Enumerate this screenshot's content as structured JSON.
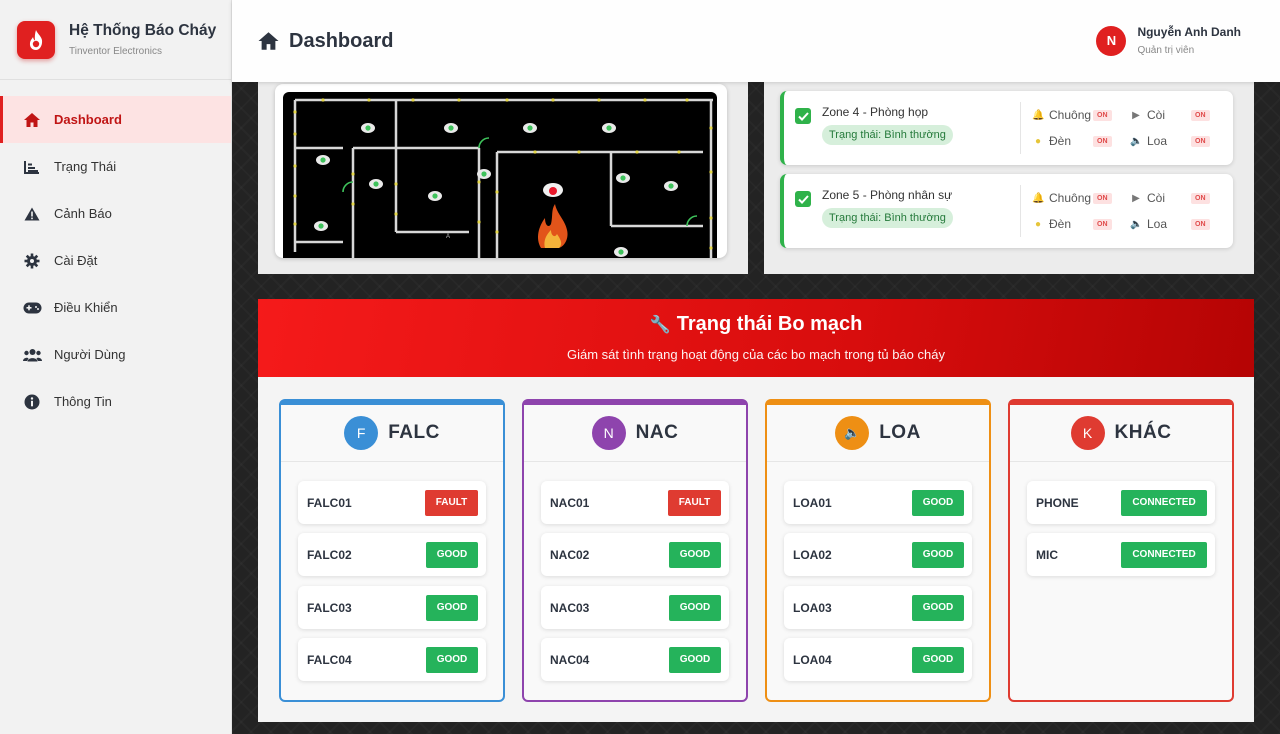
{
  "brand": {
    "title": "Hệ Thống Báo Cháy",
    "subtitle": "Tinventor Electronics"
  },
  "nav": [
    {
      "label": "Dashboard",
      "icon": "home-icon",
      "active": true
    },
    {
      "label": "Trạng Thái",
      "icon": "chart-icon"
    },
    {
      "label": "Cảnh Báo",
      "icon": "warning-icon"
    },
    {
      "label": "Cài Đặt",
      "icon": "gear-icon"
    },
    {
      "label": "Điều Khiển",
      "icon": "gamepad-icon"
    },
    {
      "label": "Người Dùng",
      "icon": "users-icon"
    },
    {
      "label": "Thông Tin",
      "icon": "info-icon"
    }
  ],
  "header": {
    "title": "Dashboard",
    "icon": "home-icon"
  },
  "user": {
    "initial": "N",
    "name": "Nguyễn Anh Danh",
    "role": "Quản trị viên"
  },
  "zones": [
    {
      "name": "Zone 4 - Phòng họp",
      "state": "Trạng thái: Bình thường",
      "devices": {
        "chuong": "Chuông",
        "coi": "Còi",
        "den": "Đèn",
        "loa": "Loa"
      },
      "badges": {
        "chuong": "ON",
        "coi": "ON",
        "den": "ON",
        "loa": "ON"
      }
    },
    {
      "name": "Zone 5 - Phòng nhân sự",
      "state": "Trạng thái: Bình thường",
      "devices": {
        "chuong": "Chuông",
        "coi": "Còi",
        "den": "Đèn",
        "loa": "Loa"
      },
      "badges": {
        "chuong": "ON",
        "coi": "ON",
        "den": "ON",
        "loa": "ON"
      }
    }
  ],
  "board": {
    "title": "Trạng thái Bo mạch",
    "subtitle": "Giám sát tình trạng hoạt động của các bo mạch trong tủ báo cháy",
    "groups": [
      {
        "icon_letter": "F",
        "name": "FALC",
        "color": "#3a8fd6",
        "items": [
          {
            "name": "FALC01",
            "status": "FAULT"
          },
          {
            "name": "FALC02",
            "status": "GOOD"
          },
          {
            "name": "FALC03",
            "status": "GOOD"
          },
          {
            "name": "FALC04",
            "status": "GOOD"
          }
        ]
      },
      {
        "icon_letter": "N",
        "name": "NAC",
        "color": "#8e44ad",
        "items": [
          {
            "name": "NAC01",
            "status": "FAULT"
          },
          {
            "name": "NAC02",
            "status": "GOOD"
          },
          {
            "name": "NAC03",
            "status": "GOOD"
          },
          {
            "name": "NAC04",
            "status": "GOOD"
          }
        ]
      },
      {
        "icon_letter": "🔈",
        "name": "LOA",
        "color": "#ee8f14",
        "items": [
          {
            "name": "LOA01",
            "status": "GOOD"
          },
          {
            "name": "LOA02",
            "status": "GOOD"
          },
          {
            "name": "LOA03",
            "status": "GOOD"
          },
          {
            "name": "LOA04",
            "status": "GOOD"
          }
        ]
      },
      {
        "icon_letter": "K",
        "name": "KHÁC",
        "color": "#df3b31",
        "items": [
          {
            "name": "PHONE",
            "status": "CONNECTED"
          },
          {
            "name": "MIC",
            "status": "CONNECTED"
          }
        ]
      }
    ]
  },
  "colors": {
    "accent": "#e02020",
    "good": "#25b35b",
    "fault": "#df3b31",
    "zone_ok": "#2fb24a"
  }
}
